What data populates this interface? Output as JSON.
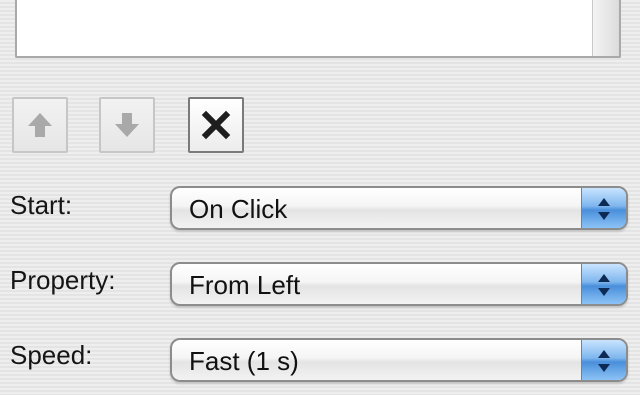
{
  "form": {
    "start": {
      "label": "Start:",
      "value": "On Click"
    },
    "property": {
      "label": "Property:",
      "value": "From Left"
    },
    "speed": {
      "label": "Speed:",
      "value": "Fast (1 s)"
    }
  },
  "toolbar": {
    "move_up_icon": "arrow-up-icon",
    "move_down_icon": "arrow-down-icon",
    "delete_icon": "close-icon"
  },
  "colors": {
    "popup_accent": "#4a8fdb",
    "background": "#ececec"
  }
}
